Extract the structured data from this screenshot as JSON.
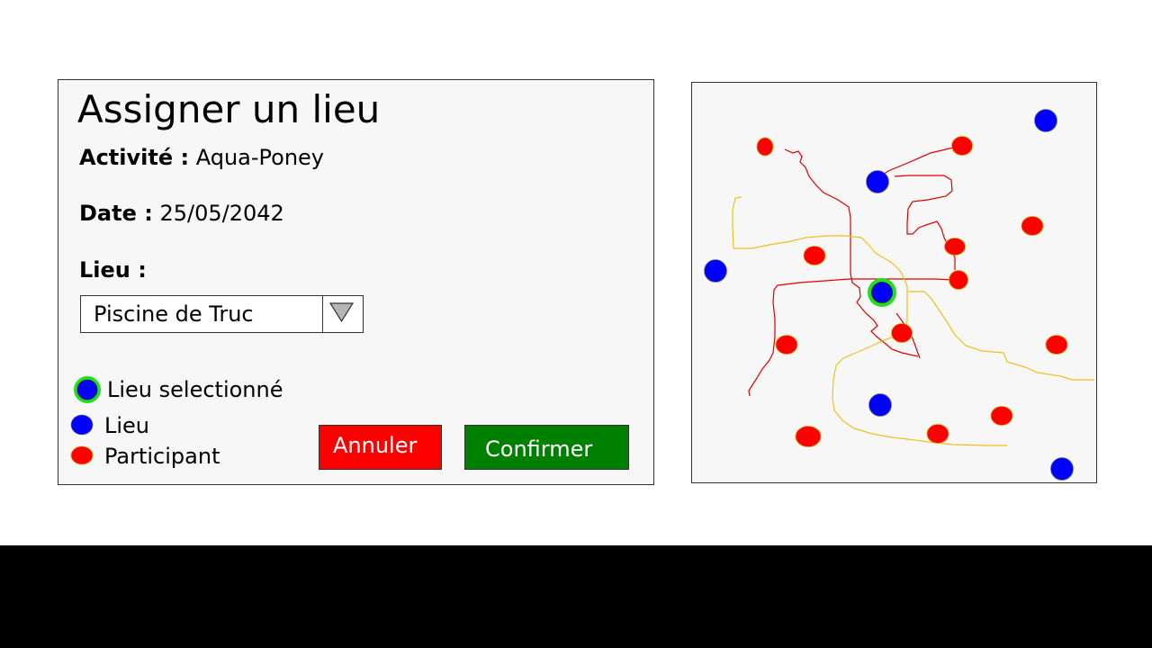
{
  "dialog": {
    "title": "Assigner un lieu",
    "activity_label": "Activité :",
    "activity_value": "Aqua-Poney",
    "date_label": "Date :",
    "date_value": "25/05/2042",
    "place_label": "Lieu :",
    "place_selected": "Piscine de Truc"
  },
  "legend": {
    "selected_place": "Lieu selectionné",
    "place": "Lieu",
    "participant": "Participant"
  },
  "buttons": {
    "cancel": "Annuler",
    "confirm": "Confirmer"
  },
  "colors": {
    "place": "#0000ff",
    "participant": "#ff0000",
    "selected_ring": "#22dd22",
    "cancel": "#ff0000",
    "confirm": "#008000",
    "route_red": "#dd0000",
    "route_yellow": "#f0c020"
  },
  "icons": {
    "dropdown": "triangle-down-icon"
  }
}
